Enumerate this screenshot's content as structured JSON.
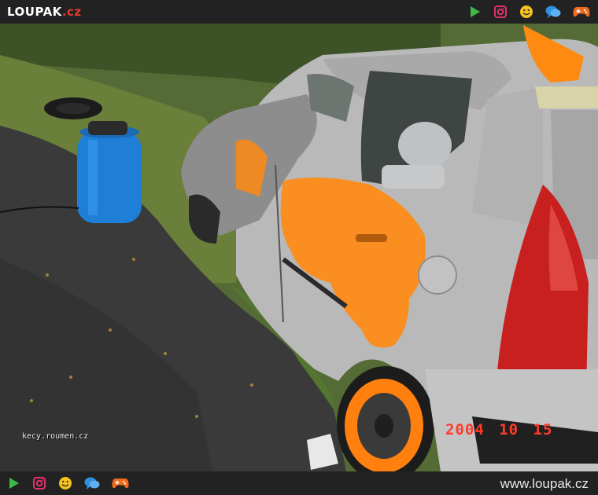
{
  "header": {
    "logo_main": "LOUPAK",
    "logo_tld": ".cz",
    "icons": [
      "play-icon",
      "instagram-icon",
      "smiley-icon",
      "chat-icon",
      "gamepad-icon"
    ]
  },
  "photo": {
    "subject": "crashed-car-photo",
    "watermark": "kecy.roumen.cz",
    "date_stamp": "2004 10 15"
  },
  "footer": {
    "icons": [
      "play-icon",
      "instagram-icon",
      "smiley-icon",
      "chat-icon",
      "gamepad-icon"
    ],
    "site_url": "www.loupak.cz"
  },
  "colors": {
    "bar": "#222222",
    "play": "#3db84a",
    "instagram": "#e1306c",
    "smiley": "#f6c21c",
    "chat": "#2e8fe0",
    "gamepad": "#f06a1e",
    "date_stamp": "#ff3b2a",
    "car_paint": "#b9b9b9",
    "accent_paint": "#ff8a12"
  }
}
